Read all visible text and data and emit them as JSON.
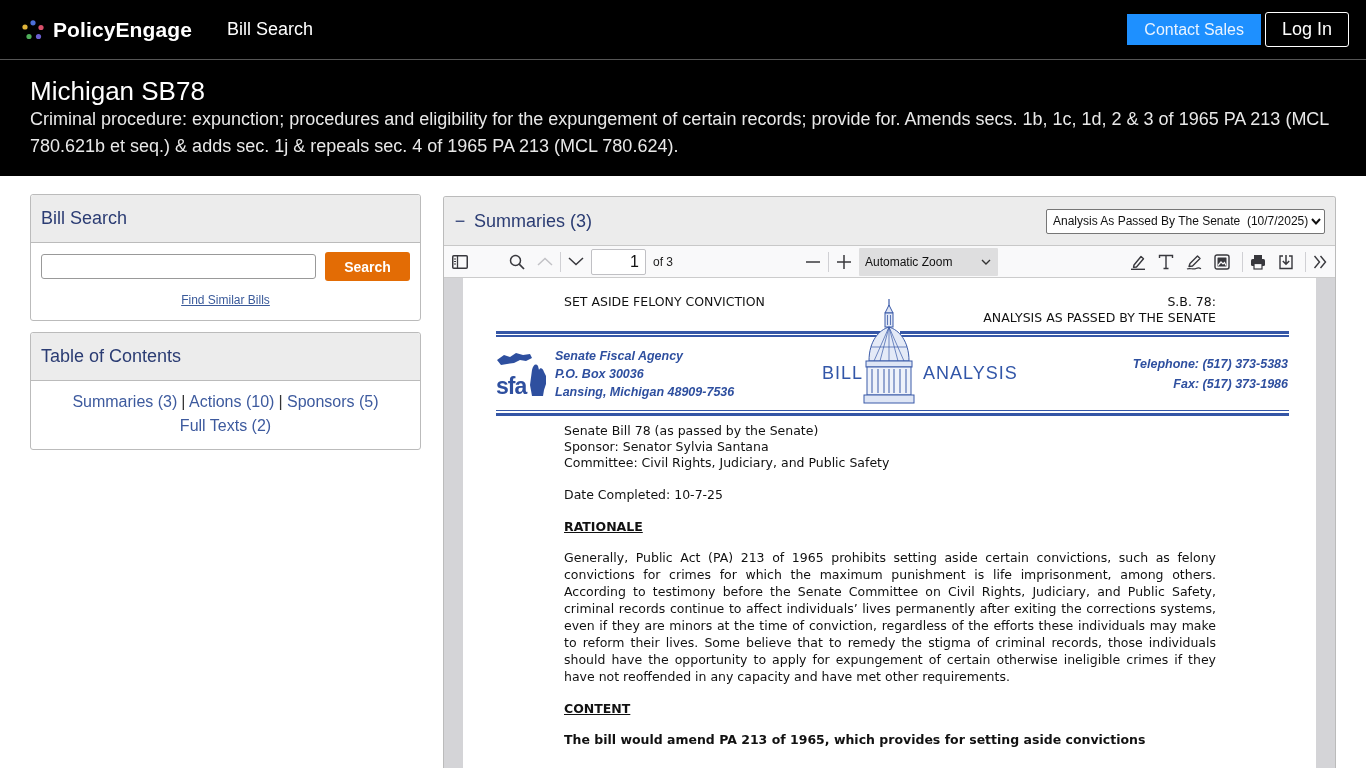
{
  "navbar": {
    "brand": "PolicyEngage",
    "links": [
      {
        "label": "Bill Search"
      }
    ],
    "buttons": [
      {
        "label": "Contact Sales",
        "kind": "primary"
      },
      {
        "label": "Log In",
        "kind": "outline"
      }
    ]
  },
  "bill": {
    "title": "Michigan SB78",
    "description": "Criminal procedure: expunction; procedures and eligibility for the expungement of certain records; provide for. Amends secs. 1b, 1c, 1d, 2 & 3 of 1965 PA 213 (MCL 780.621b et seq.) & adds sec. 1j & repeals sec. 4 of 1965 PA 213 (MCL 780.624)."
  },
  "bill_search": {
    "title": "Bill Search",
    "button": "Search",
    "link": "Find Similar Bills"
  },
  "table_of_contents": {
    "title": "Table of Contents",
    "links": [
      {
        "label": "Summaries (3)",
        "separator": "|"
      },
      {
        "label": "Actions (10)",
        "separator": "|"
      },
      {
        "label": "Sponsors (5)"
      },
      {
        "label": "Full Texts (2)"
      }
    ]
  },
  "summaries": {
    "toggle": "−",
    "title": "Summaries (3)",
    "expanded": true,
    "document_select": "Analysis As Passed By The Senate  (10/7/2025)",
    "pdf_toolbar": {
      "page": "1",
      "page_count": "of 3",
      "zoom": "Automatic Zoom",
      "previous_disabled": true,
      "next_disabled": false
    },
    "document": {
      "running_title": "SET ASIDE FELONY CONVICTION",
      "bill_reference": "S.B. 78:",
      "analysis_stage": "ANALYSIS AS PASSED BY THE SENATE",
      "logo_letters": "sfa",
      "agency_lines": [
        "Senate Fiscal Agency",
        "P.O. Box 30036",
        "Lansing, Michigan 48909-7536"
      ],
      "banner": [
        "BILL",
        "ANALYSIS"
      ],
      "contact_lines": [
        "Telephone: (517) 373-5383",
        "Fax: (517) 373-1986"
      ],
      "details": [
        "Senate Bill 78 (as passed by the Senate)",
        "Sponsor: Senator Sylvia Santana",
        "Committee: Civil Rights, Judiciary, and Public Safety"
      ],
      "date_completed": "Date Completed: 10-7-25",
      "sections": [
        {
          "heading": "RATIONALE",
          "body": "Generally, Public Act (PA) 213 of 1965 prohibits setting aside certain convictions, such as felony convictions for crimes for which the maximum punishment is life imprisonment, among others. According to testimony before the Senate Committee on Civil Rights, Judiciary, and Public Safety, criminal records continue to affect individuals’ lives permanently after exiting the corrections systems, even if they are minors at the time of conviction, regardless of the efforts these individuals may make to reform their lives. Some believe that to remedy the stigma of criminal records, those individuals should have the opportunity to apply for expungement of certain otherwise ineligible crimes if they have not reoffended in any capacity and have met other requirements.",
          "bold_body": false
        },
        {
          "heading": "CONTENT",
          "body": "The bill would amend PA 213 of 1965, which provides for setting aside convictions",
          "bold_body": true
        }
      ]
    }
  }
}
